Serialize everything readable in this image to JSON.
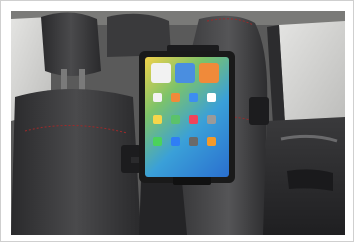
{
  "photo": {
    "subject": "tablet-headrest-mount",
    "colors": {
      "interior_dark": "#2e2e30",
      "seat_leather": "#3a3a3c",
      "stitch_red": "#9c2a2a",
      "window_light": "#d8d8d6",
      "screen_blue": "#3aa0d8",
      "screen_green": "#7cc36a",
      "screen_yellow": "#f2d24a"
    },
    "screen_apps": [
      {
        "name": "app-icon-clock",
        "color": "#f2f2f2"
      },
      {
        "name": "app-icon-photos",
        "color": "#f08a3a"
      },
      {
        "name": "app-icon-mail",
        "color": "#3d8ef0"
      },
      {
        "name": "app-icon-calendar",
        "color": "#ffffff"
      },
      {
        "name": "app-icon-notes",
        "color": "#f6d64a"
      },
      {
        "name": "app-icon-maps",
        "color": "#5bc26a"
      },
      {
        "name": "app-icon-music",
        "color": "#f0445a"
      },
      {
        "name": "app-icon-settings",
        "color": "#9a9a9a"
      },
      {
        "name": "app-icon-messages",
        "color": "#4bd25c"
      },
      {
        "name": "app-icon-store",
        "color": "#2f7ef5"
      },
      {
        "name": "app-icon-camera",
        "color": "#6a6a6a"
      },
      {
        "name": "app-icon-books",
        "color": "#f39a2a"
      }
    ],
    "dock_apps": [
      {
        "name": "dock-icon-phone",
        "color": "#4bd25c"
      },
      {
        "name": "dock-icon-safari",
        "color": "#2f8ef5"
      },
      {
        "name": "dock-icon-messages",
        "color": "#5bd66a"
      },
      {
        "name": "dock-icon-music",
        "color": "#f0445a"
      },
      {
        "name": "dock-icon-photos",
        "color": "#f4b23a"
      },
      {
        "name": "dock-icon-files",
        "color": "#3a7ef0"
      }
    ]
  }
}
